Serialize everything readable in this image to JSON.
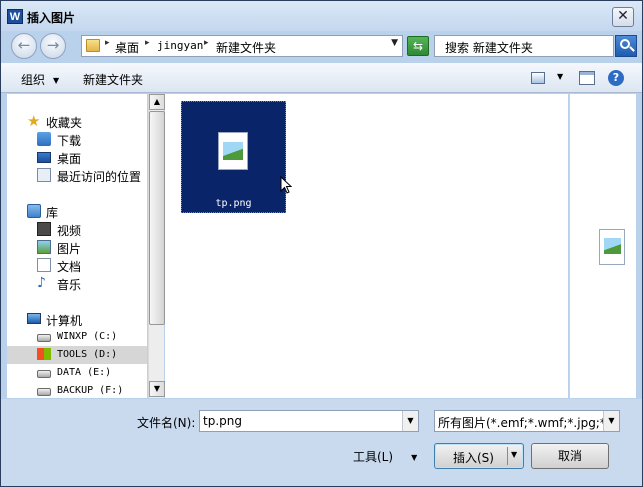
{
  "window": {
    "title": "插入图片",
    "app_icon_letter": "W",
    "close_glyph": "✕"
  },
  "address": {
    "breadcrumbs": [
      "桌面",
      "jingyan",
      "新建文件夹"
    ],
    "search_text": "搜索 新建文件夹"
  },
  "toolbar": {
    "organize_label": "组织",
    "new_folder_label": "新建文件夹"
  },
  "nav": {
    "favorites_label": "收藏夹",
    "favorites": [
      "下载",
      "桌面",
      "最近访问的位置"
    ],
    "libraries_label": "库",
    "libraries": [
      "视频",
      "图片",
      "文档",
      "音乐"
    ],
    "computer_label": "计算机",
    "drives": [
      "WINXP (C:)",
      "TOOLS (D:)",
      "DATA (E:)",
      "BACKUP (F:)"
    ]
  },
  "files": [
    {
      "name": "tp.png"
    }
  ],
  "bottom": {
    "filename_label": "文件名(N):",
    "filename_value": "tp.png",
    "filetype_value": "所有图片(*.emf;*.wmf;*.jpg;*.jp",
    "tools_label": "工具(L)",
    "insert_label": "插入(S)",
    "cancel_label": "取消"
  },
  "colors": {
    "selection": "#0a246a",
    "window_frame": "#b9d1ea"
  }
}
